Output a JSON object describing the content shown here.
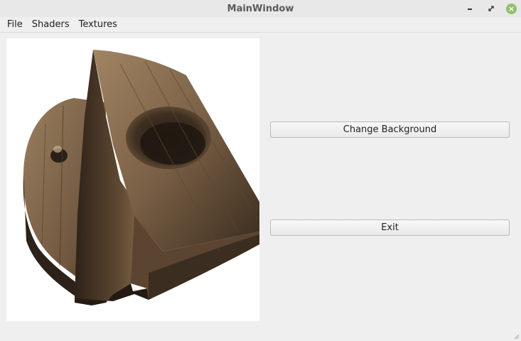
{
  "window": {
    "title": "MainWindow"
  },
  "menubar": {
    "items": [
      "File",
      "Shaders",
      "Textures"
    ]
  },
  "buttons": {
    "change_background": "Change Background",
    "exit": "Exit"
  },
  "colors": {
    "window_bg": "#efefef",
    "viewport_bg": "#ffffff",
    "close_button": "#8fbf6c",
    "wood": "#7a6046"
  },
  "icons": {
    "minimize": "minimize-icon",
    "restore": "restore-icon",
    "close": "close-icon"
  }
}
